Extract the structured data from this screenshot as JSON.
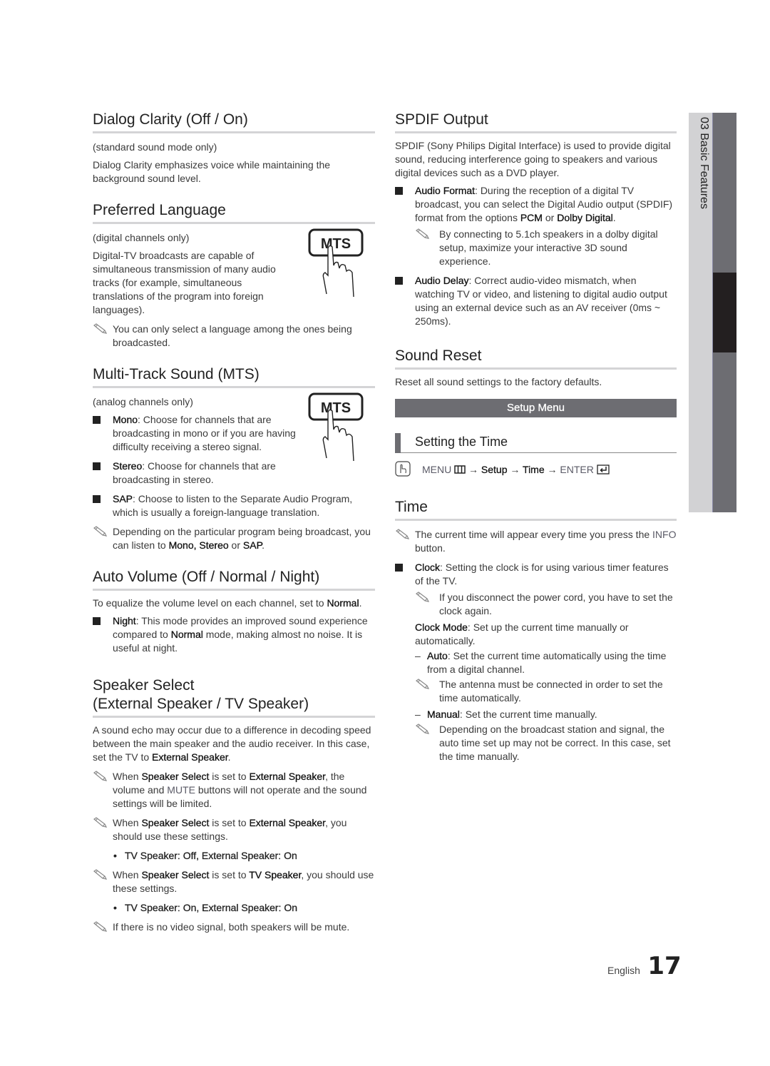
{
  "left_column": {
    "dialog_clarity": {
      "title": "Dialog Clarity (Off / On)",
      "condition": "(standard sound mode only)",
      "body": "Dialog Clarity emphasizes voice while maintaining the background sound level."
    },
    "preferred_language": {
      "title": "Preferred Language",
      "condition": "(digital channels only)",
      "body": "Digital-TV broadcasts are capable of simultaneous transmission of many audio tracks (for example, simultaneous translations of the program into foreign languages).",
      "note": "You can only select a language among the ones being broadcasted.",
      "button_label": "MTS"
    },
    "mts": {
      "title": "Multi-Track Sound (MTS)",
      "condition": "(analog channels only)",
      "button_label": "MTS",
      "items": [
        {
          "term": "Mono",
          "text": ": Choose for channels that are broadcasting in mono or if you are having difficulty receiving a stereo signal."
        },
        {
          "term": "Stereo",
          "text": ": Choose for channels that are broadcasting in stereo."
        },
        {
          "term": "SAP",
          "text": ": Choose to listen to the Separate Audio Program, which is usually a foreign-language translation."
        }
      ],
      "note_prefix": "Depending on the particular program being broadcast, you can listen to ",
      "note_terms": "Mono, Stereo",
      "note_or": " or ",
      "note_sap": "SAP",
      "note_end": "."
    },
    "auto_volume": {
      "title": "Auto Volume (Off / Normal / Night)",
      "body_prefix": "To equalize the volume level on each channel, set to ",
      "body_term": "Normal",
      "body_end": ".",
      "item_term": "Night",
      "item_text1": ": This mode provides an improved sound experience compared to ",
      "item_term2": "Normal",
      "item_text2": " mode, making almost no noise. It is useful at night."
    },
    "speaker_select": {
      "title_line1": "Speaker Select",
      "title_line2": "(External Speaker / TV Speaker)",
      "body_prefix": "A sound echo may occur due to a difference in decoding speed between the main speaker and the audio receiver. In this case, set the TV to ",
      "body_term": "External Speaker",
      "body_end": ".",
      "note1": {
        "a": "When ",
        "b": "Speaker Select",
        "c": " is set to ",
        "d": "External Speaker",
        "e": ", the volume and ",
        "f": "MUTE",
        "g": " buttons will not operate and the sound settings will be limited."
      },
      "note2": {
        "a": "When ",
        "b": "Speaker Select",
        "c": " is set to ",
        "d": "External Speaker",
        "e": ", you should use these settings."
      },
      "bullet1": "TV Speaker: Off, External Speaker: On",
      "note3": {
        "a": "When ",
        "b": "Speaker Select",
        "c": " is set to ",
        "d": "TV Speaker",
        "e": ", you should use these settings."
      },
      "bullet2": "TV Speaker: On, External Speaker: On",
      "note4": "If there is no video signal, both speakers will be mute."
    }
  },
  "right_column": {
    "spdif": {
      "title": "SPDIF Output",
      "body": "SPDIF (Sony Philips Digital Interface) is used to provide digital sound, reducing interference going to speakers and various digital devices such as a DVD player.",
      "audio_format": {
        "term": "Audio Format",
        "text1": ": During the reception of a digital TV broadcast, you can select the Digital Audio output (SPDIF) format from the options ",
        "pcm": "PCM",
        "or": " or ",
        "dolby": "Dolby Digital",
        "end": "."
      },
      "audio_format_note": "By connecting to 5.1ch speakers in a dolby digital setup, maximize your interactive 3D sound experience.",
      "audio_delay": {
        "term": "Audio Delay",
        "text": ": Correct audio-video mismatch, when watching TV or video, and listening to digital audio output using an external device such as an AV receiver (0ms ~ 250ms)."
      }
    },
    "sound_reset": {
      "title": "Sound Reset",
      "body": "Reset all sound settings to the factory defaults."
    },
    "setup_menu_label": "Setup Menu",
    "setting_time": {
      "title": "Setting the Time",
      "path": {
        "menu": "MENU",
        "arrow1": " → ",
        "setup": "Setup",
        "arrow2": " → ",
        "time": "Time",
        "arrow3": " → ",
        "enter": "ENTER"
      }
    },
    "time": {
      "title": "Time",
      "note1_a": "The current time will appear every time you press the ",
      "note1_info": "INFO",
      "note1_b": " button.",
      "clock_term": "Clock",
      "clock_text": ": Setting the clock is for using various timer features of the TV.",
      "clock_note": "If you disconnect the power cord, you have to set the clock again.",
      "clock_mode_term": "Clock Mode",
      "clock_mode_text": ": Set up the current time manually or automatically.",
      "auto_term": "Auto",
      "auto_text": ": Set the current time automatically using the time from a digital channel.",
      "auto_note": "The antenna must be connected in order to set the time automatically.",
      "manual_term": "Manual",
      "manual_text": ": Set the current time manually.",
      "manual_note": "Depending on the broadcast station and signal, the auto time set up may not be correct. In this case, set the time manually."
    }
  },
  "sidebar": {
    "chapter_label": "03  Basic Features"
  },
  "footer": {
    "language": "English",
    "page_number": "17"
  }
}
